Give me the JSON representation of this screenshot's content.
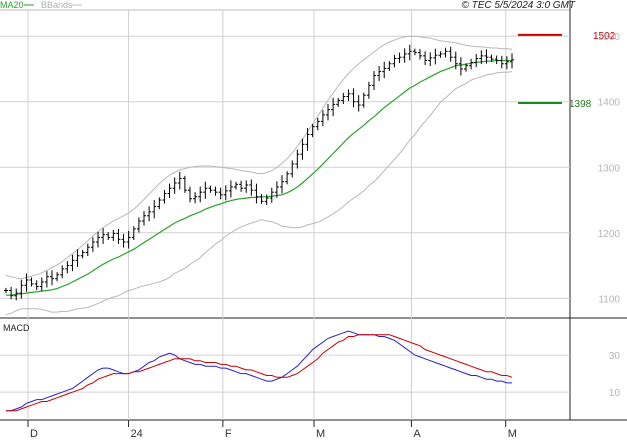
{
  "header": {
    "legend_ma": "MA20",
    "legend_bbands": "BBands",
    "copyright": "© TEC 5/5/2024 3:0 GMT"
  },
  "macd_panel": {
    "title": "MACD"
  },
  "colors": {
    "ma20": "#2aa02a",
    "bbands": "#b8b8b8",
    "price": "#000000",
    "macd_line": "#2222cc",
    "signal_line": "#cc0000",
    "level_red": "#cc0000",
    "level_green": "#1b8a1b",
    "grid": "#d0d0d0"
  },
  "chart_data": [
    {
      "type": "ohlc",
      "title": "",
      "x_tick_labels": [
        "D",
        "24",
        "F",
        "M",
        "A",
        "M"
      ],
      "x_tick_dates": [
        "2023-12-01",
        "2024-01-02",
        "2024-02-01",
        "2024-03-01",
        "2024-04-01",
        "2024-05-01"
      ],
      "y_tick_labels": [
        "1100",
        "1200",
        "1300",
        "1400",
        "1500"
      ],
      "ylim": [
        1070,
        1540
      ],
      "grid": true,
      "levels": [
        {
          "label": "1502",
          "value": 1502,
          "color": "red"
        },
        {
          "label": "1398",
          "value": 1398,
          "color": "green"
        }
      ],
      "close": [
        1112,
        1104,
        1108,
        1120,
        1128,
        1122,
        1118,
        1125,
        1133,
        1130,
        1136,
        1145,
        1150,
        1158,
        1165,
        1170,
        1178,
        1186,
        1193,
        1197,
        1193,
        1199,
        1190,
        1186,
        1193,
        1206,
        1218,
        1226,
        1232,
        1240,
        1250,
        1260,
        1268,
        1276,
        1283,
        1265,
        1252,
        1255,
        1262,
        1268,
        1265,
        1262,
        1258,
        1264,
        1270,
        1274,
        1268,
        1273,
        1265,
        1255,
        1248,
        1253,
        1262,
        1270,
        1278,
        1290,
        1305,
        1320,
        1335,
        1350,
        1362,
        1370,
        1380,
        1388,
        1396,
        1402,
        1408,
        1412,
        1400,
        1395,
        1410,
        1425,
        1440,
        1446,
        1451,
        1458,
        1466,
        1468,
        1473,
        1477,
        1475,
        1470,
        1463,
        1467,
        1471,
        1473,
        1477,
        1468,
        1458,
        1450,
        1455,
        1460,
        1466,
        1470,
        1468,
        1465,
        1463,
        1458,
        1461,
        1464
      ],
      "ma20": [
        1105,
        1105,
        1106,
        1107,
        1108,
        1109,
        1110,
        1111,
        1112,
        1113,
        1115,
        1118,
        1121,
        1125,
        1129,
        1133,
        1137,
        1142,
        1147,
        1152,
        1156,
        1160,
        1163,
        1167,
        1171,
        1175,
        1180,
        1185,
        1190,
        1195,
        1200,
        1205,
        1210,
        1215,
        1219,
        1222,
        1226,
        1229,
        1232,
        1236,
        1239,
        1242,
        1244,
        1247,
        1249,
        1251,
        1252,
        1253,
        1254,
        1254,
        1255,
        1255,
        1256,
        1257,
        1258,
        1261,
        1265,
        1270,
        1276,
        1283,
        1290,
        1297,
        1305,
        1313,
        1321,
        1329,
        1337,
        1345,
        1352,
        1358,
        1364,
        1371,
        1377,
        1384,
        1391,
        1397,
        1403,
        1409,
        1415,
        1421,
        1425,
        1430,
        1434,
        1438,
        1442,
        1446,
        1449,
        1452,
        1455,
        1456,
        1457,
        1459,
        1460,
        1461,
        1462,
        1462,
        1463,
        1463,
        1463,
        1463
      ],
      "bb_upper": [
        1135,
        1133,
        1131,
        1130,
        1132,
        1134,
        1136,
        1139,
        1143,
        1147,
        1151,
        1156,
        1162,
        1168,
        1174,
        1181,
        1188,
        1195,
        1202,
        1208,
        1213,
        1218,
        1222,
        1226,
        1230,
        1236,
        1243,
        1251,
        1259,
        1267,
        1275,
        1282,
        1288,
        1292,
        1296,
        1298,
        1300,
        1301,
        1302,
        1302,
        1302,
        1301,
        1300,
        1299,
        1298,
        1297,
        1295,
        1294,
        1293,
        1291,
        1290,
        1292,
        1295,
        1300,
        1306,
        1313,
        1322,
        1332,
        1343,
        1354,
        1366,
        1378,
        1390,
        1402,
        1413,
        1424,
        1434,
        1443,
        1451,
        1458,
        1464,
        1470,
        1476,
        1482,
        1487,
        1491,
        1494,
        1497,
        1499,
        1500,
        1500,
        1499,
        1498,
        1497,
        1495,
        1493,
        1492,
        1491,
        1490,
        1488,
        1486,
        1485,
        1484,
        1484,
        1483,
        1482,
        1482,
        1481,
        1481,
        1480
      ],
      "bb_lower": [
        1075,
        1077,
        1081,
        1084,
        1084,
        1084,
        1084,
        1083,
        1081,
        1079,
        1079,
        1080,
        1080,
        1082,
        1084,
        1085,
        1086,
        1089,
        1092,
        1096,
        1099,
        1102,
        1104,
        1108,
        1112,
        1114,
        1117,
        1119,
        1121,
        1123,
        1125,
        1128,
        1132,
        1138,
        1142,
        1146,
        1152,
        1157,
        1162,
        1170,
        1176,
        1183,
        1188,
        1195,
        1200,
        1205,
        1209,
        1212,
        1215,
        1217,
        1220,
        1218,
        1217,
        1214,
        1210,
        1209,
        1208,
        1208,
        1209,
        1212,
        1214,
        1216,
        1220,
        1224,
        1229,
        1234,
        1240,
        1247,
        1253,
        1258,
        1264,
        1272,
        1278,
        1286,
        1295,
        1303,
        1312,
        1321,
        1331,
        1342,
        1350,
        1361,
        1370,
        1379,
        1389,
        1399,
        1406,
        1413,
        1420,
        1424,
        1428,
        1433,
        1436,
        1438,
        1441,
        1442,
        1444,
        1445,
        1445,
        1446
      ]
    },
    {
      "type": "line",
      "title": "MACD",
      "y_tick_labels": [
        "30",
        "10"
      ],
      "ylim": [
        -5,
        50
      ],
      "series": [
        {
          "values": [
            0,
            0,
            1,
            2,
            4,
            5,
            6,
            6,
            7,
            8,
            9,
            10,
            11,
            12,
            14,
            16,
            18,
            20,
            22,
            23,
            23,
            22,
            21,
            20,
            20,
            21,
            22,
            24,
            26,
            27,
            29,
            30,
            31,
            30,
            28,
            27,
            26,
            25,
            25,
            24,
            24,
            24,
            23,
            23,
            22,
            21,
            20,
            20,
            19,
            18,
            17,
            16,
            16,
            17,
            18,
            20,
            22,
            24,
            27,
            30,
            33,
            35,
            37,
            39,
            40,
            41,
            42,
            43,
            42,
            41,
            41,
            41,
            41,
            40,
            40,
            39,
            38,
            36,
            34,
            32,
            30,
            29,
            28,
            27,
            26,
            25,
            24,
            23,
            22,
            21,
            20,
            19,
            19,
            18,
            17,
            17,
            16,
            16,
            15,
            15
          ]
        },
        {
          "values": [
            0,
            0,
            0,
            1,
            2,
            3,
            4,
            5,
            5,
            6,
            7,
            8,
            9,
            10,
            11,
            12,
            14,
            15,
            17,
            18,
            19,
            20,
            20,
            20,
            20,
            21,
            21,
            22,
            23,
            24,
            25,
            26,
            27,
            28,
            28,
            28,
            28,
            27,
            27,
            26,
            26,
            26,
            25,
            25,
            24,
            24,
            23,
            22,
            22,
            21,
            20,
            19,
            19,
            18,
            18,
            18,
            19,
            20,
            22,
            24,
            26,
            28,
            31,
            33,
            35,
            37,
            38,
            40,
            40,
            41,
            41,
            41,
            41,
            41,
            41,
            41,
            40,
            39,
            38,
            37,
            36,
            35,
            33,
            32,
            31,
            30,
            29,
            28,
            27,
            26,
            25,
            24,
            23,
            22,
            21,
            21,
            20,
            19,
            19,
            18
          ]
        }
      ]
    }
  ]
}
